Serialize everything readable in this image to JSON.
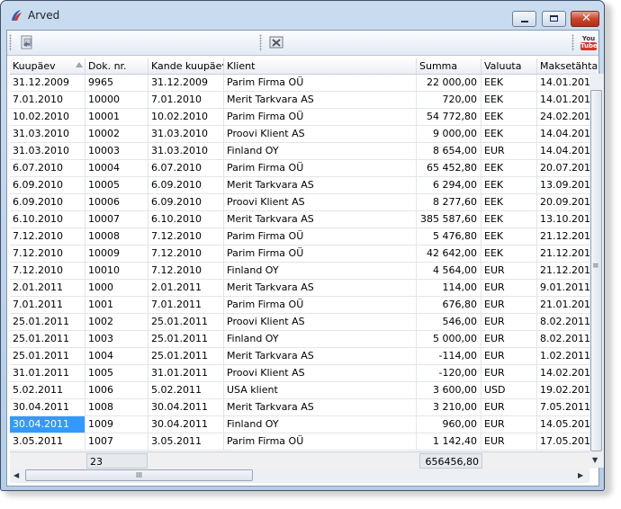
{
  "window": {
    "title": "Arved"
  },
  "toolbar": {
    "youtube_label_top": "You",
    "youtube_label_bottom": "Tube"
  },
  "grid": {
    "columns": [
      "Kuupäev",
      "Dok. nr.",
      "Kande kuupäev",
      "Klient",
      "Summa",
      "Valuuta",
      "Maksetähtaeg"
    ],
    "rows": [
      [
        "31.12.2009",
        "9965",
        "31.12.2009",
        "Parim Firma OÜ",
        "22 000,00",
        "EEK",
        "14.01.2010"
      ],
      [
        "7.01.2010",
        "10000",
        "7.01.2010",
        "Merit Tarkvara AS",
        "720,00",
        "EEK",
        "14.01.2010"
      ],
      [
        "10.02.2010",
        "10001",
        "10.02.2010",
        "Parim Firma OÜ",
        "54 772,80",
        "EEK",
        "24.02.2010"
      ],
      [
        "31.03.2010",
        "10002",
        "31.03.2010",
        "Proovi Klient AS",
        "9 000,00",
        "EEK",
        "14.04.2010"
      ],
      [
        "31.03.2010",
        "10003",
        "31.03.2010",
        "Finland OY",
        "8 654,00",
        "EUR",
        "14.04.2010"
      ],
      [
        "6.07.2010",
        "10004",
        "6.07.2010",
        "Parim Firma OÜ",
        "65 452,80",
        "EEK",
        "20.07.2010"
      ],
      [
        "6.09.2010",
        "10005",
        "6.09.2010",
        "Merit Tarkvara AS",
        "6 294,00",
        "EEK",
        "13.09.2010"
      ],
      [
        "6.09.2010",
        "10006",
        "6.09.2010",
        "Proovi Klient AS",
        "8 277,60",
        "EEK",
        "20.09.2010"
      ],
      [
        "6.10.2010",
        "10007",
        "6.10.2010",
        "Merit Tarkvara AS",
        "385 587,60",
        "EEK",
        "13.10.2010"
      ],
      [
        "7.12.2010",
        "10008",
        "7.12.2010",
        "Parim Firma OÜ",
        "5 476,80",
        "EEK",
        "21.12.2010"
      ],
      [
        "7.12.2010",
        "10009",
        "7.12.2010",
        "Parim Firma OÜ",
        "42 642,00",
        "EEK",
        "21.12.2010"
      ],
      [
        "7.12.2010",
        "10010",
        "7.12.2010",
        "Finland OY",
        "4 564,00",
        "EUR",
        "21.12.2010"
      ],
      [
        "2.01.2011",
        "1000",
        "2.01.2011",
        "Merit Tarkvara AS",
        "114,00",
        "EUR",
        "9.01.2011"
      ],
      [
        "7.01.2011",
        "1001",
        "7.01.2011",
        "Parim Firma OÜ",
        "676,80",
        "EUR",
        "21.01.2011"
      ],
      [
        "25.01.2011",
        "1002",
        "25.01.2011",
        "Proovi Klient AS",
        "546,00",
        "EUR",
        "8.02.2011"
      ],
      [
        "25.01.2011",
        "1003",
        "25.01.2011",
        "Finland OY",
        "5 000,00",
        "EUR",
        "8.02.2011"
      ],
      [
        "25.01.2011",
        "1004",
        "25.01.2011",
        "Merit Tarkvara AS",
        "-114,00",
        "EUR",
        "1.02.2011"
      ],
      [
        "31.01.2011",
        "1005",
        "31.01.2011",
        "Proovi Klient AS",
        "-120,00",
        "EUR",
        "14.02.2011"
      ],
      [
        "5.02.2011",
        "1006",
        "5.02.2011",
        "USA klient",
        "3 600,00",
        "USD",
        "19.02.2011"
      ],
      [
        "30.04.2011",
        "1008",
        "30.04.2011",
        "Merit Tarkvara AS",
        "3 210,00",
        "EUR",
        "7.05.2011"
      ],
      [
        "30.04.2011",
        "1009",
        "30.04.2011",
        "Finland OY",
        "960,00",
        "EUR",
        "14.05.2011"
      ],
      [
        "3.05.2011",
        "1007",
        "3.05.2011",
        "Parim Firma OÜ",
        "1 142,40",
        "EUR",
        "17.05.2011"
      ]
    ],
    "selected_row": 20,
    "footer": {
      "count": "23",
      "total": "656456,80"
    }
  },
  "scrollbar": {
    "hthumb_grip": "III",
    "vthumb_grip": "≡"
  },
  "colors": {
    "selection": "#3399ff",
    "close_button": "#c7462b",
    "app_icon_blue": "#2f5fb5",
    "app_icon_red": "#d8342a"
  }
}
